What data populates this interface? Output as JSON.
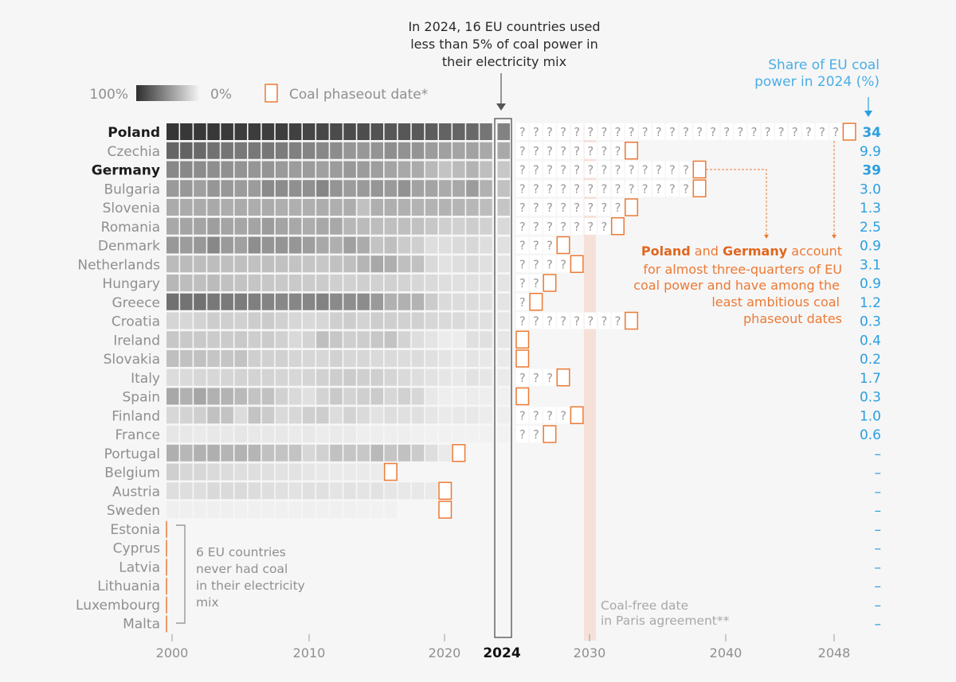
{
  "chart_data": {
    "type": "heatmap",
    "title": "",
    "x_start": 2000,
    "x_end_history": 2024,
    "x_end_axis": 2048,
    "x_ticks": [
      "2000",
      "2010",
      "2020",
      "2024",
      "2030",
      "2040",
      "2048"
    ],
    "x_tick_bold": "2024",
    "legend": {
      "scale_high": "100%",
      "scale_low": "0%",
      "phaseout_label": "Coal phaseout date*"
    },
    "annotations": {
      "top": [
        "In 2024, 16 EU countries used",
        "less than 5% of coal power in",
        "their electricity mix"
      ],
      "share_title": [
        "Share of EU coal",
        "power in 2024 (%)"
      ],
      "orange": {
        "line1_a": "Poland",
        "line1_b": " and ",
        "line1_c": "Germany",
        "line1_d": " account",
        "lines": [
          "for almost three-quarters of EU",
          "coal power and have among the",
          "least ambitious coal",
          "phaseout dates"
        ]
      },
      "never_coal": [
        "6 EU countries",
        "never had coal",
        "in their electricity",
        "mix"
      ],
      "paris": [
        "Coal-free date",
        "in Paris agreement**"
      ],
      "paris_year": 2030,
      "unknown_glyph": "?"
    },
    "colors": {
      "dark": "#2e2e2e",
      "orange": "#ec7a35",
      "blue": "#2b9fe0",
      "paris_band": "#f6e1d9"
    },
    "countries": [
      {
        "name": "Poland",
        "bold": true,
        "phaseout": 2049,
        "share": "34",
        "share_bold": true,
        "values": [
          96,
          95,
          95,
          95,
          94,
          93,
          93,
          92,
          92,
          91,
          88,
          87,
          85,
          85,
          84,
          81,
          79,
          79,
          78,
          76,
          73,
          72,
          70,
          64,
          57
        ]
      },
      {
        "name": "Czechia",
        "bold": false,
        "phaseout": 2033,
        "share": "9.9",
        "share_bold": false,
        "values": [
          72,
          73,
          70,
          66,
          64,
          62,
          62,
          63,
          60,
          58,
          56,
          54,
          52,
          47,
          46,
          48,
          51,
          49,
          48,
          44,
          42,
          40,
          41,
          38,
          37
        ]
      },
      {
        "name": "Germany",
        "bold": true,
        "phaseout": 2038,
        "share": "39",
        "share_bold": true,
        "values": [
          54,
          54,
          52,
          51,
          50,
          48,
          47,
          48,
          45,
          44,
          44,
          42,
          44,
          46,
          44,
          43,
          40,
          38,
          36,
          29,
          24,
          28,
          32,
          26,
          22
        ]
      },
      {
        "name": "Bulgaria",
        "bold": false,
        "phaseout": 2038,
        "share": "3.0",
        "share_bold": false,
        "values": [
          45,
          46,
          42,
          47,
          46,
          44,
          44,
          53,
          52,
          50,
          50,
          55,
          48,
          44,
          45,
          47,
          45,
          49,
          41,
          40,
          36,
          38,
          44,
          33,
          25
        ]
      },
      {
        "name": "Slovenia",
        "bold": false,
        "phaseout": 2033,
        "share": "1.3",
        "share_bold": false,
        "values": [
          36,
          36,
          36,
          37,
          35,
          36,
          35,
          36,
          34,
          34,
          34,
          35,
          34,
          35,
          25,
          34,
          34,
          33,
          32,
          32,
          32,
          31,
          30,
          27,
          23
        ]
      },
      {
        "name": "Romania",
        "bold": false,
        "phaseout": 2032,
        "share": "2.5",
        "share_bold": false,
        "values": [
          38,
          40,
          40,
          43,
          40,
          39,
          40,
          44,
          40,
          38,
          35,
          38,
          38,
          30,
          28,
          27,
          26,
          26,
          25,
          22,
          18,
          17,
          19,
          17,
          13
        ]
      },
      {
        "name": "Denmark",
        "bold": false,
        "phaseout": 2028,
        "share": "0.9",
        "share_bold": false,
        "values": [
          46,
          44,
          46,
          54,
          45,
          42,
          51,
          48,
          48,
          47,
          43,
          38,
          34,
          42,
          36,
          24,
          26,
          20,
          18,
          10,
          10,
          12,
          14,
          10,
          9
        ]
      },
      {
        "name": "Netherlands",
        "bold": false,
        "phaseout": 2029,
        "share": "3.1",
        "share_bold": false,
        "values": [
          28,
          28,
          27,
          27,
          26,
          26,
          25,
          26,
          25,
          24,
          23,
          22,
          25,
          26,
          31,
          38,
          34,
          26,
          25,
          13,
          8,
          10,
          12,
          9,
          7
        ]
      },
      {
        "name": "Hungary",
        "bold": false,
        "phaseout": 2027,
        "share": "0.9",
        "share_bold": false,
        "values": [
          30,
          27,
          26,
          28,
          25,
          24,
          23,
          22,
          21,
          21,
          20,
          20,
          18,
          17,
          18,
          17,
          17,
          16,
          14,
          12,
          10,
          9,
          9,
          8,
          7
        ]
      },
      {
        "name": "Greece",
        "bold": false,
        "phaseout": 2026,
        "share": "1.2",
        "share_bold": false,
        "values": [
          66,
          65,
          66,
          62,
          61,
          60,
          58,
          56,
          54,
          55,
          55,
          57,
          53,
          51,
          52,
          45,
          33,
          33,
          32,
          20,
          12,
          11,
          11,
          9,
          7
        ]
      },
      {
        "name": "Croatia",
        "bold": false,
        "phaseout": 2033,
        "share": "0.3",
        "share_bold": false,
        "values": [
          15,
          14,
          16,
          19,
          18,
          17,
          19,
          20,
          17,
          14,
          13,
          14,
          18,
          19,
          16,
          19,
          18,
          17,
          17,
          14,
          12,
          12,
          10,
          9,
          6
        ]
      },
      {
        "name": "Ireland",
        "bold": false,
        "phaseout": 2025,
        "share": "0.4",
        "share_bold": false,
        "values": [
          22,
          21,
          21,
          20,
          20,
          21,
          19,
          20,
          17,
          13,
          16,
          26,
          22,
          18,
          19,
          22,
          24,
          16,
          10,
          7,
          3,
          3,
          9,
          9,
          6
        ]
      },
      {
        "name": "Slovakia",
        "bold": false,
        "phaseout": 2025,
        "share": "0.2",
        "share_bold": false,
        "values": [
          26,
          25,
          25,
          23,
          23,
          24,
          18,
          17,
          17,
          15,
          14,
          14,
          17,
          14,
          14,
          12,
          12,
          11,
          11,
          9,
          7,
          5,
          7,
          5,
          4
        ]
      },
      {
        "name": "Italy",
        "bold": false,
        "phaseout": 2028,
        "share": "1.7",
        "share_bold": false,
        "values": [
          11,
          12,
          14,
          14,
          15,
          16,
          16,
          16,
          15,
          14,
          15,
          17,
          19,
          20,
          18,
          18,
          15,
          12,
          10,
          8,
          6,
          5,
          8,
          6,
          4
        ]
      },
      {
        "name": "Spain",
        "bold": false,
        "phaseout": 2025,
        "share": "0.3",
        "share_bold": false,
        "values": [
          38,
          33,
          39,
          33,
          32,
          29,
          24,
          25,
          17,
          13,
          9,
          16,
          21,
          16,
          18,
          20,
          14,
          17,
          14,
          5,
          2,
          2,
          3,
          2,
          1
        ]
      },
      {
        "name": "Finland",
        "bold": false,
        "phaseout": 2029,
        "share": "1.0",
        "share_bold": false,
        "values": [
          14,
          16,
          18,
          25,
          24,
          11,
          24,
          20,
          12,
          14,
          18,
          19,
          11,
          16,
          12,
          8,
          10,
          9,
          9,
          6,
          4,
          5,
          5,
          3,
          2
        ]
      },
      {
        "name": "France",
        "bold": false,
        "phaseout": 2027,
        "share": "0.6",
        "share_bold": false,
        "values": [
          6,
          5,
          4,
          5,
          5,
          6,
          5,
          5,
          5,
          4,
          5,
          3,
          4,
          4,
          2,
          2,
          2,
          2,
          1,
          0.5,
          0.4,
          0.4,
          0.5,
          0.3,
          0.2
        ]
      },
      {
        "name": "Portugal",
        "bold": false,
        "phaseout": 2021,
        "share": "–",
        "share_bold": false,
        "values": [
          34,
          30,
          33,
          34,
          31,
          32,
          31,
          25,
          24,
          24,
          14,
          17,
          25,
          23,
          22,
          29,
          23,
          25,
          20,
          10,
          4,
          null,
          null,
          null,
          null
        ]
      },
      {
        "name": "Belgium",
        "bold": false,
        "phaseout": 2016,
        "share": "–",
        "share_bold": false,
        "values": [
          18,
          14,
          14,
          12,
          11,
          10,
          10,
          9,
          8,
          8,
          6,
          5,
          4,
          4,
          4,
          3,
          null,
          null,
          null,
          null,
          null,
          null,
          null,
          null,
          null
        ]
      },
      {
        "name": "Austria",
        "bold": false,
        "phaseout": 2020,
        "share": "–",
        "share_bold": false,
        "values": [
          10,
          10,
          10,
          13,
          12,
          12,
          11,
          10,
          9,
          8,
          9,
          9,
          7,
          8,
          7,
          8,
          6,
          5,
          5,
          4,
          null,
          null,
          null,
          null,
          null
        ]
      },
      {
        "name": "Sweden",
        "bold": false,
        "phaseout": 2020,
        "share": "–",
        "share_bold": false,
        "values": [
          1.5,
          1.5,
          1.5,
          1.7,
          1.4,
          1.1,
          1.2,
          1,
          1.1,
          1,
          1.3,
          1.2,
          0.9,
          0.8,
          0.6,
          0.5,
          0.6,
          null,
          null,
          null,
          null,
          null,
          null,
          null,
          null
        ]
      },
      {
        "name": "Estonia",
        "bold": false,
        "phaseout": null,
        "share": "–",
        "share_bold": false,
        "values": []
      },
      {
        "name": "Cyprus",
        "bold": false,
        "phaseout": null,
        "share": "–",
        "share_bold": false,
        "values": []
      },
      {
        "name": "Latvia",
        "bold": false,
        "phaseout": null,
        "share": "–",
        "share_bold": false,
        "values": []
      },
      {
        "name": "Lithuania",
        "bold": false,
        "phaseout": null,
        "share": "–",
        "share_bold": false,
        "values": []
      },
      {
        "name": "Luxembourg",
        "bold": false,
        "phaseout": null,
        "share": "–",
        "share_bold": false,
        "values": []
      },
      {
        "name": "Malta",
        "bold": false,
        "phaseout": null,
        "share": "–",
        "share_bold": false,
        "values": []
      }
    ]
  }
}
